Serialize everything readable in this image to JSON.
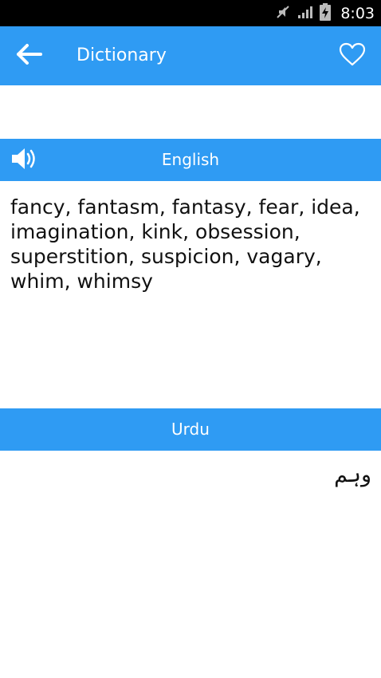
{
  "status_bar": {
    "time": "8:03",
    "icons": [
      "mute-icon",
      "signal-icon",
      "battery-charging-icon"
    ]
  },
  "app_bar": {
    "title": "Dictionary",
    "back_icon": "arrow-left-icon",
    "favorite_icon": "heart-outline-icon"
  },
  "english_section": {
    "label": "English",
    "speaker_icon": "speaker-icon",
    "text": "fancy, fantasm, fantasy, fear, idea, imagination, kink, obsession, superstition, suspicion, vagary, whim, whimsy"
  },
  "urdu_section": {
    "label": "Urdu",
    "text": "وہم"
  },
  "colors": {
    "primary": "#2f9bf3",
    "status_bar": "#000000",
    "background": "#ffffff",
    "text": "#111111"
  }
}
